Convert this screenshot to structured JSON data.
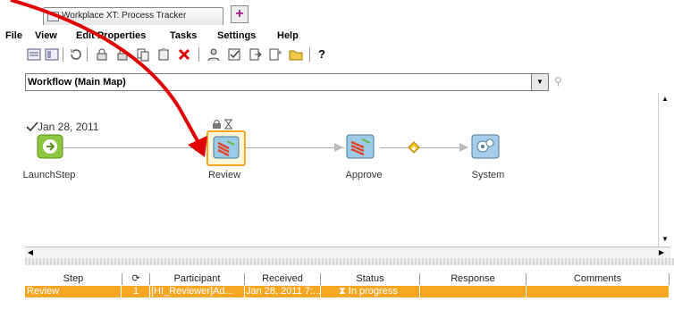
{
  "tab": {
    "title": "Workplace XT: Process Tracker"
  },
  "menu": [
    {
      "label": "File",
      "key": "F"
    },
    {
      "label": "View",
      "key": "V"
    },
    {
      "label": "Edit Properties",
      "key": "E"
    },
    {
      "label": "Tasks",
      "key": "T"
    },
    {
      "label": "Settings",
      "key": "S"
    },
    {
      "label": "Help",
      "key": "H"
    }
  ],
  "toolbar": {
    "help_label": "?"
  },
  "workflow_select": {
    "value": "Workflow (Main Map)"
  },
  "map": {
    "start_date": "Jan 28, 2011",
    "nodes": [
      {
        "label": "LaunchStep"
      },
      {
        "label": "Review"
      },
      {
        "label": "Approve"
      },
      {
        "label": "System"
      }
    ]
  },
  "table": {
    "headers": [
      "Step",
      "⟳",
      "Participant",
      "Received",
      "Status",
      "Response",
      "Comments"
    ],
    "rows": [
      {
        "step": "Review",
        "count": "1",
        "participant": "[HI_Reviewer]Ad...",
        "received": "Jan 28, 2011 7:...",
        "status": "In progress",
        "response": "",
        "comments": ""
      }
    ]
  },
  "colors": {
    "selected_row": "#f5a623",
    "annotation": "#e00000"
  }
}
